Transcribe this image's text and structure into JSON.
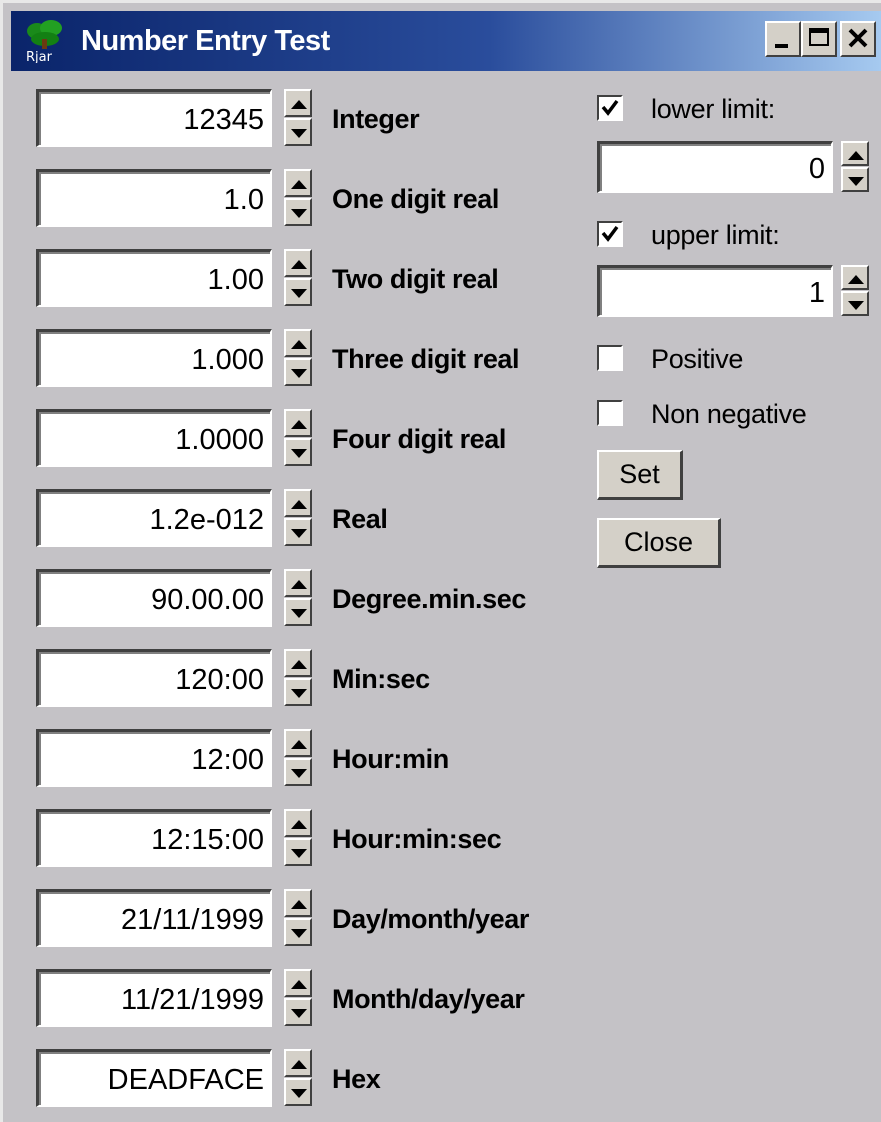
{
  "window": {
    "title": "Number Entry Test",
    "icon": "tree-app-icon",
    "icon_text": "Rjar",
    "controls": [
      "minimize",
      "maximize",
      "close"
    ]
  },
  "entries": [
    {
      "value": "12345",
      "label": "Integer"
    },
    {
      "value": "1.0",
      "label": "One digit real"
    },
    {
      "value": "1.00",
      "label": "Two digit real"
    },
    {
      "value": "1.000",
      "label": "Three digit real"
    },
    {
      "value": "1.0000",
      "label": "Four digit real"
    },
    {
      "value": "1.2e-012",
      "label": "Real"
    },
    {
      "value": "90.00.00",
      "label": "Degree.min.sec"
    },
    {
      "value": "120:00",
      "label": "Min:sec"
    },
    {
      "value": "12:00",
      "label": "Hour:min"
    },
    {
      "value": "12:15:00",
      "label": "Hour:min:sec"
    },
    {
      "value": "21/11/1999",
      "label": "Day/month/year"
    },
    {
      "value": "11/21/1999",
      "label": "Month/day/year"
    },
    {
      "value": "DEADFACE",
      "label": "Hex"
    }
  ],
  "options": {
    "lower_limit": {
      "label": "lower limit:",
      "checked": true,
      "value": "0"
    },
    "upper_limit": {
      "label": "upper limit:",
      "checked": true,
      "value": "1"
    },
    "positive": {
      "label": "Positive",
      "checked": false
    },
    "non_negative": {
      "label": "Non negative",
      "checked": false
    }
  },
  "buttons": {
    "set": "Set",
    "close": "Close"
  },
  "colors": {
    "window_bg": "#c4c2c6",
    "title_bg_start": "#0a246a",
    "title_bg_end": "#a6caf0",
    "field_bg": "#ffffff"
  }
}
